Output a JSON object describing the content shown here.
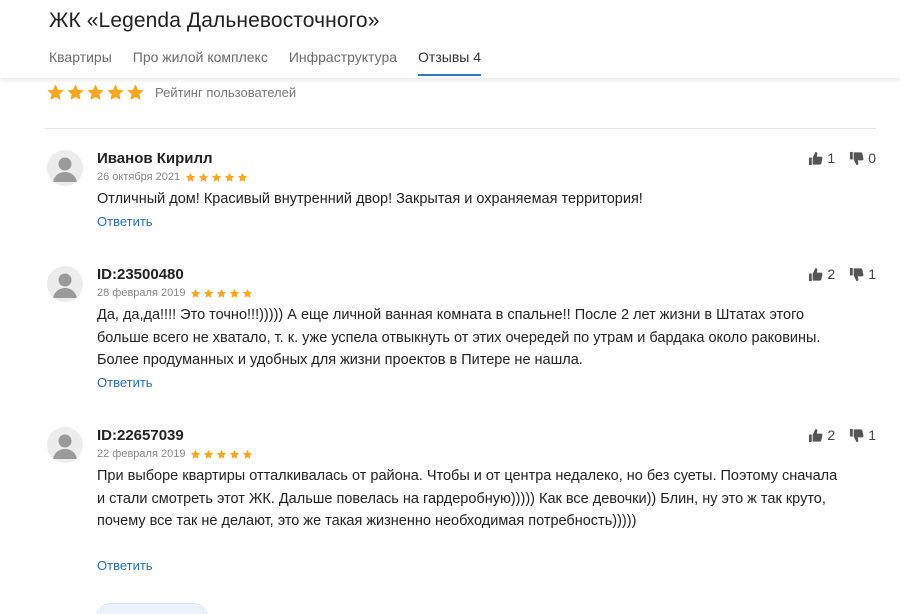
{
  "header": {
    "title": "ЖК «Legenda Дальневосточного»",
    "tabs": [
      {
        "label": "Квартиры",
        "active": false
      },
      {
        "label": "Про жилой комплекс",
        "active": false
      },
      {
        "label": "Инфраструктура",
        "active": false
      },
      {
        "label": "Отзывы 4",
        "active": true
      }
    ]
  },
  "rating": {
    "stars": 5,
    "label": "Рейтинг пользователей"
  },
  "colors": {
    "star": "#f7a823",
    "accent": "#2d7cc9",
    "link": "#2d6ea8"
  },
  "reviews": [
    {
      "author": "Иванов Кирилл",
      "date": "26 октября 2021",
      "stars": 5,
      "text": "Отличный дом! Красивый внутренний двор! Закрытая и охраняемая территория!",
      "reply": "Ответить",
      "likes": "1",
      "dislikes": "0"
    },
    {
      "author": "ID:23500480",
      "date": "28 февраля 2019",
      "stars": 5,
      "text": "Да, да,да!!!! Это точно!!!))))) А еще личной ванная комната в спальне!! После 2 лет жизни в Штатах этого больше всего не хватало, т. к. уже успела отвыкнуть от этих очередей по утрам и бардака около раковины. Более продуманных и удобных для жизни проектов в Питере не нашла.",
      "reply": "Ответить",
      "likes": "2",
      "dislikes": "1"
    },
    {
      "author": "ID:22657039",
      "date": "22 февраля 2019",
      "stars": 5,
      "text": "При выборе квартиры отталкивалась от района. Чтобы и от центра недалеко, но без суеты. Поэтому сначала и стали смотреть этот ЖК. Дальше повелась на гардеробную))))) Как все девочки)) Блин, ну это ж так круто, почему все так не делают, это же такая жизненно необходимая потребность)))))",
      "reply": "Ответить",
      "likes": "2",
      "dislikes": "1"
    }
  ],
  "icons": {
    "star": "star-icon",
    "like": "thumbs-up-icon",
    "dislike": "thumbs-down-icon",
    "avatar": "user-avatar-icon"
  }
}
